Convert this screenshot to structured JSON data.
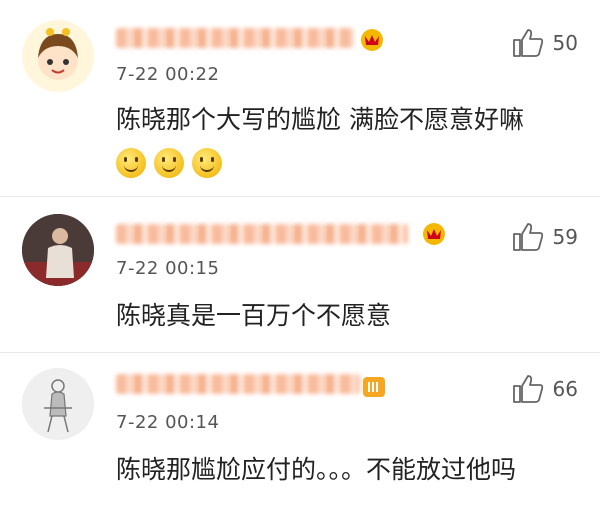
{
  "comments": [
    {
      "likes": "50",
      "time": "7-22 00:22",
      "text": "陈晓那个大写的尴尬  满脸不愿意好嘛",
      "avatar_icon": "cartoon-bee-girl",
      "emoji_count": 3
    },
    {
      "likes": "59",
      "time": "7-22 00:15",
      "text": "陈晓真是一百万个不愿意",
      "avatar_icon": "person-photo"
    },
    {
      "likes": "66",
      "time": "7-22 00:14",
      "text": "陈晓那尴尬应付的。。。不能放过他吗",
      "avatar_icon": "sketch-figure"
    }
  ],
  "colors": {
    "accent": "#f5a47c",
    "badge": "#f5b800",
    "text": "#222222"
  }
}
